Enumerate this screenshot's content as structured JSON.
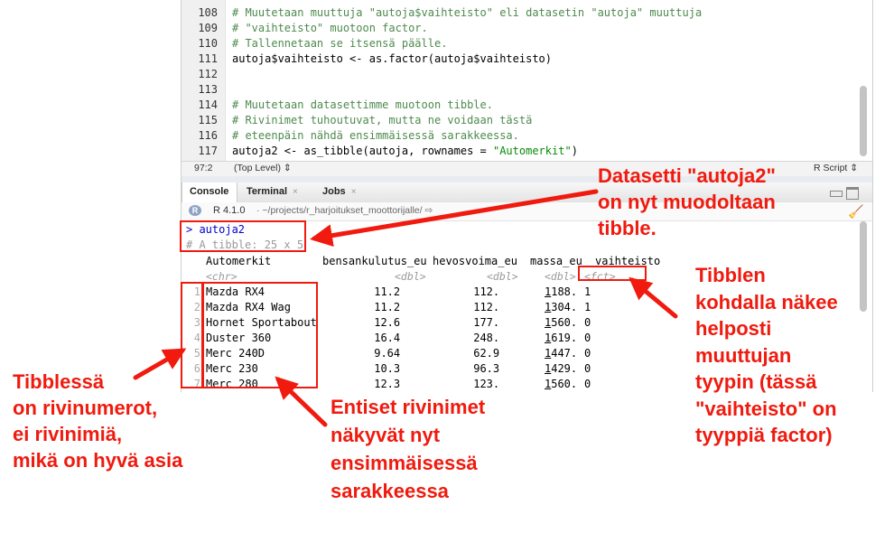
{
  "editor": {
    "lines": [
      {
        "n": "108",
        "parts": [
          {
            "t": "# Muutetaan muuttuja \"autoja$vaihteisto\" eli datasetin \"autoja\" muuttuja",
            "c": "cmt"
          }
        ]
      },
      {
        "n": "109",
        "parts": [
          {
            "t": "# \"vaihteisto\" muotoon factor.",
            "c": "cmt"
          }
        ]
      },
      {
        "n": "110",
        "parts": [
          {
            "t": "# Tallennetaan se itsensä päälle.",
            "c": "cmt"
          }
        ]
      },
      {
        "n": "111",
        "parts": [
          {
            "t": "autoja$vaihteisto <- as.factor(autoja$vaihteisto)",
            "c": ""
          }
        ]
      },
      {
        "n": "112",
        "parts": []
      },
      {
        "n": "113",
        "parts": []
      },
      {
        "n": "114",
        "parts": [
          {
            "t": "# Muutetaan datasettimme muotoon tibble.",
            "c": "cmt"
          }
        ]
      },
      {
        "n": "115",
        "parts": [
          {
            "t": "# Rivinimet tuhoutuvat, mutta ne voidaan tästä",
            "c": "cmt"
          }
        ]
      },
      {
        "n": "116",
        "parts": [
          {
            "t": "# eteenpäin nähdä ensimmäisessä sarakkeessa.",
            "c": "cmt"
          }
        ]
      },
      {
        "n": "117",
        "parts": [
          {
            "t": "autoja2 <- as_tibble(autoja, rownames = ",
            "c": ""
          },
          {
            "t": "\"Automerkit\"",
            "c": "str"
          },
          {
            "t": ")",
            "c": ""
          }
        ]
      }
    ]
  },
  "status": {
    "position": "97:2",
    "scope": "(Top Level) ⇕",
    "filetype": "R Script ⇕"
  },
  "tabs": [
    {
      "label": "Console",
      "close": ""
    },
    {
      "label": "Terminal",
      "close": "×"
    },
    {
      "label": "Jobs",
      "close": "×"
    }
  ],
  "console_header": {
    "version": "R 4.1.0",
    "path": "· ~/projects/r_harjoitukset_moottorijalle/ ⇨"
  },
  "console": {
    "prompt": "> autoja2",
    "tibble_info": "# A tibble: 25 x 5",
    "columns": [
      "Automerkit",
      "bensankulutus_eu",
      "hevosvoima_eu",
      "massa_eu",
      "vaihteisto"
    ],
    "types": [
      "<chr>",
      "<dbl>",
      "<dbl>",
      "<dbl>",
      "<fct>"
    ],
    "rows": [
      {
        "n": "1",
        "car": "Mazda RX4",
        "bens": "11.2",
        "hv": "112.",
        "massa_lead": "1",
        "massa_rest": "188.",
        "vaiht": "1"
      },
      {
        "n": "2",
        "car": "Mazda RX4 Wag",
        "bens": "11.2",
        "hv": "112.",
        "massa_lead": "1",
        "massa_rest": "304.",
        "vaiht": "1"
      },
      {
        "n": "3",
        "car": "Hornet Sportabout",
        "bens": "12.6",
        "hv": "177.",
        "massa_lead": "1",
        "massa_rest": "560.",
        "vaiht": "0"
      },
      {
        "n": "4",
        "car": "Duster 360",
        "bens": "16.4",
        "hv": "248.",
        "massa_lead": "1",
        "massa_rest": "619.",
        "vaiht": "0"
      },
      {
        "n": "5",
        "car": "Merc 240D",
        "bens": "9.64",
        "hv": "62.9",
        "massa_lead": "1",
        "massa_rest": "447.",
        "vaiht": "0"
      },
      {
        "n": "6",
        "car": "Merc 230",
        "bens": "10.3",
        "hv": "96.3",
        "massa_lead": "1",
        "massa_rest": "429.",
        "vaiht": "0"
      },
      {
        "n": "7",
        "car": "Merc 280",
        "bens": "12.3",
        "hv": "123.",
        "massa_lead": "1",
        "massa_rest": "560.",
        "vaiht": "0"
      }
    ]
  },
  "annotations": {
    "dataset": "Datasetti \"autoja2\"\non nyt muodoltaan\ntibble.",
    "type": "Tibblen\nkohdalla näkee\nhelposti\nmuuttujan\ntyypin (tässä\n\"vaihteisto\" on\ntyyppiä factor)",
    "rownumbers": "Tibblessä\non rivinumerot,\nei rivinimiä,\nmikä on hyvä asia",
    "rownames": "Entiset rivinimet\nnäkyvät nyt\nensimmäisessä\nsarakkeessa"
  },
  "colors": {
    "annotation": "#f01a0e",
    "comment": "#4d8a4d",
    "string": "#0b8a0b",
    "prompt": "#0000cc"
  }
}
